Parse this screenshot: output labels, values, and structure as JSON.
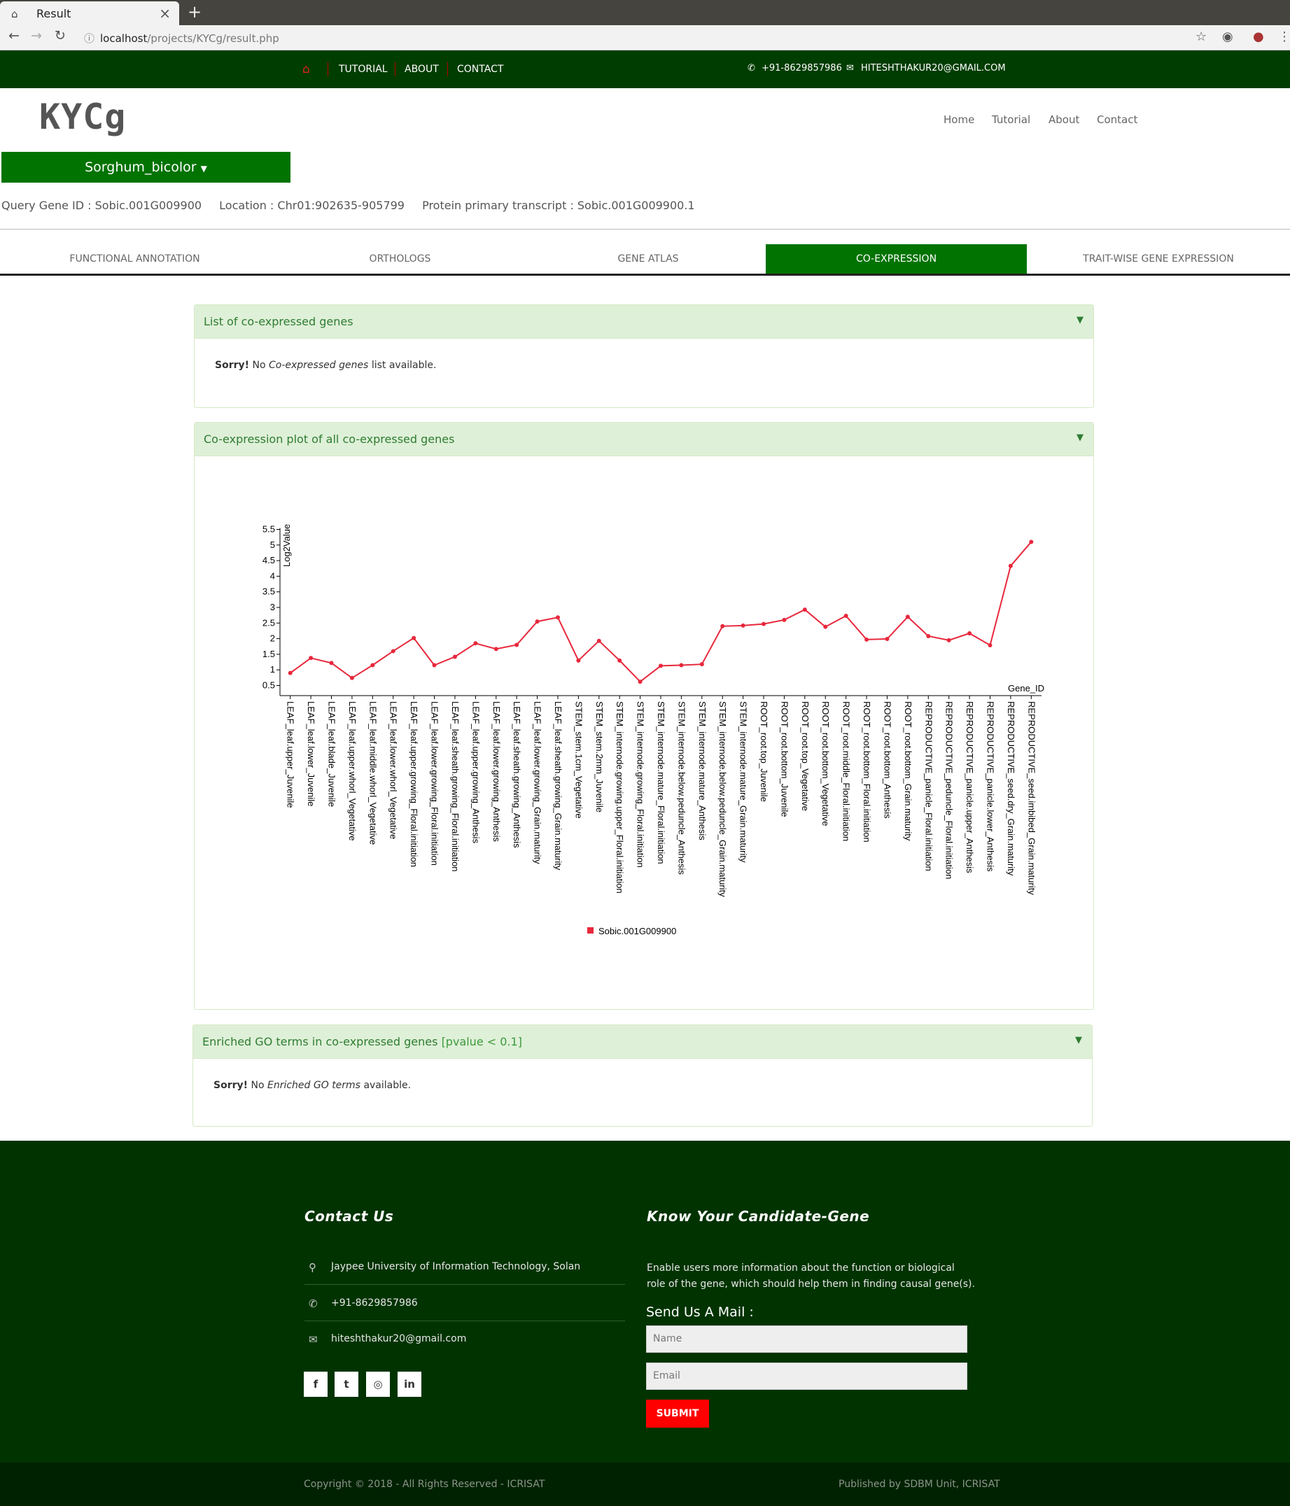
{
  "browser": {
    "tab_title": "Result",
    "url_host": "localhost",
    "url_path": "/projects/KYCg/result.php"
  },
  "topbar": {
    "links": [
      "TUTORIAL",
      "ABOUT",
      "CONTACT"
    ],
    "phone": "+91-8629857986",
    "email": "HITESHTHAKUR20@GMAIL.COM"
  },
  "header": {
    "logo": "KYCg",
    "nav": [
      "Home",
      "Tutorial",
      "About",
      "Contact"
    ]
  },
  "species": {
    "selected": "Sorghum_bicolor"
  },
  "query": {
    "gene": "Query Gene ID : Sobic.001G009900",
    "location": "Location : Chr01:902635-905799",
    "transcript": "Protein primary transcript : Sobic.001G009900.1"
  },
  "tabs": [
    "FUNCTIONAL ANNOTATION",
    "ORTHOLOGS",
    "GENE ATLAS",
    "CO-EXPRESSION",
    "TRAIT-WISE GENE EXPRESSION"
  ],
  "panels": {
    "coexp_list": {
      "title": "List of co-expressed genes",
      "sorry": "Sorry!",
      "pre": "No",
      "em": "Co-expressed genes",
      "post": "list available."
    },
    "coexp_plot": {
      "title": "Co-expression plot of all co-expressed genes"
    },
    "go_terms": {
      "title": "Enriched GO terms in co-expressed genes",
      "pvalue": "[pvalue < 0.1]",
      "sorry": "Sorry!",
      "pre": "No",
      "em": "Enriched GO terms",
      "post": "available."
    }
  },
  "chart_data": {
    "type": "line",
    "ylabel": "Log2Value",
    "xlabel": "Gene_ID",
    "ylim": [
      0.25,
      5.5
    ],
    "yticks": [
      0.5,
      1,
      1.5,
      2,
      2.5,
      3,
      3.5,
      4,
      4.5,
      5,
      5.5
    ],
    "color": "#e8283c",
    "categories": [
      "LEAF_leaf.upper_Juvenile",
      "LEAF_leaf.lower_Juvenile",
      "LEAF_leaf.blade_Juvenile",
      "LEAF_leaf.upper.whorl_Vegetative",
      "LEAF_leaf.middle.whorl_Vegetative",
      "LEAF_leaf.lower.whorl_Vegetative",
      "LEAF_leaf.upper.growing_Floral.initiation",
      "LEAF_leaf.lower.growing_Floral.initiation",
      "LEAF_leaf.sheath.growing_Floral.initiation",
      "LEAF_leaf.upper.growing_Anthesis",
      "LEAF_leaf.lower.growing_Anthesis",
      "LEAF_leaf.sheath.growing_Anthesis",
      "LEAF_leaf.lower.growing_Grain.maturity",
      "LEAF_leaf.sheath.growing_Grain.maturity",
      "STEM_stem.1cm_Vegetative",
      "STEM_stem.2mm_Juvenile",
      "STEM_internode.growing.upper_Floral.initiation",
      "STEM_internode.growing_Floral.initiation",
      "STEM_internode.mature_Floral.initiation",
      "STEM_internode.below.peduncle_Anthesis",
      "STEM_internode.mature_Anthesis",
      "STEM_internode.below.peduncle_Grain.maturity",
      "STEM_internode.mature_Grain.maturity",
      "ROOT_root.top_Juvenile",
      "ROOT_root.bottom_Juvenile",
      "ROOT_root.top_Vegetative",
      "ROOT_root.bottom_Vegetative",
      "ROOT_root.middle_Floral.initiation",
      "ROOT_root.bottom_Floral.initiation",
      "ROOT_root.bottom_Anthesis",
      "ROOT_root.bottom_Grain.maturity",
      "REPRODUCTIVE_panicle_Floral.initiation",
      "REPRODUCTIVE_peduncle_Floral.initiation",
      "REPRODUCTIVE_panicle.upper_Anthesis",
      "REPRODUCTIVE_panicle.lower_Anthesis",
      "REPRODUCTIVE_seed.dry_Grain.maturity",
      "REPRODUCTIVE_seed.imbibed_Grain.maturity"
    ],
    "series": [
      {
        "name": "Sobic.001G009900",
        "values": [
          0.9,
          1.38,
          1.22,
          0.74,
          1.15,
          1.6,
          2.02,
          1.15,
          1.42,
          1.85,
          1.67,
          1.8,
          2.55,
          2.68,
          1.3,
          1.93,
          1.3,
          0.62,
          1.13,
          1.15,
          1.18,
          2.4,
          2.42,
          2.47,
          2.6,
          2.93,
          2.38,
          2.73,
          1.97,
          1.99,
          2.7,
          2.08,
          1.95,
          2.17,
          1.79,
          4.33,
          5.1
        ]
      }
    ]
  },
  "footer": {
    "contact_title": "Contact Us",
    "address": "Jaypee University of Information Technology, Solan",
    "phone": "+91-8629857986",
    "email": "hiteshthakur20@gmail.com",
    "about_title": "Know Your Candidate-Gene",
    "about_text": "Enable users more information about the function or biological role of the gene, which should help them in finding causal gene(s).",
    "mail_title": "Send Us A Mail :",
    "name_placeholder": "Name",
    "email_placeholder": "Email",
    "submit": "SUBMIT",
    "copyright": "Copyright © 2018 - All Rights Reserved - ICRISAT",
    "published": "Published by SDBM Unit, ICRISAT"
  }
}
